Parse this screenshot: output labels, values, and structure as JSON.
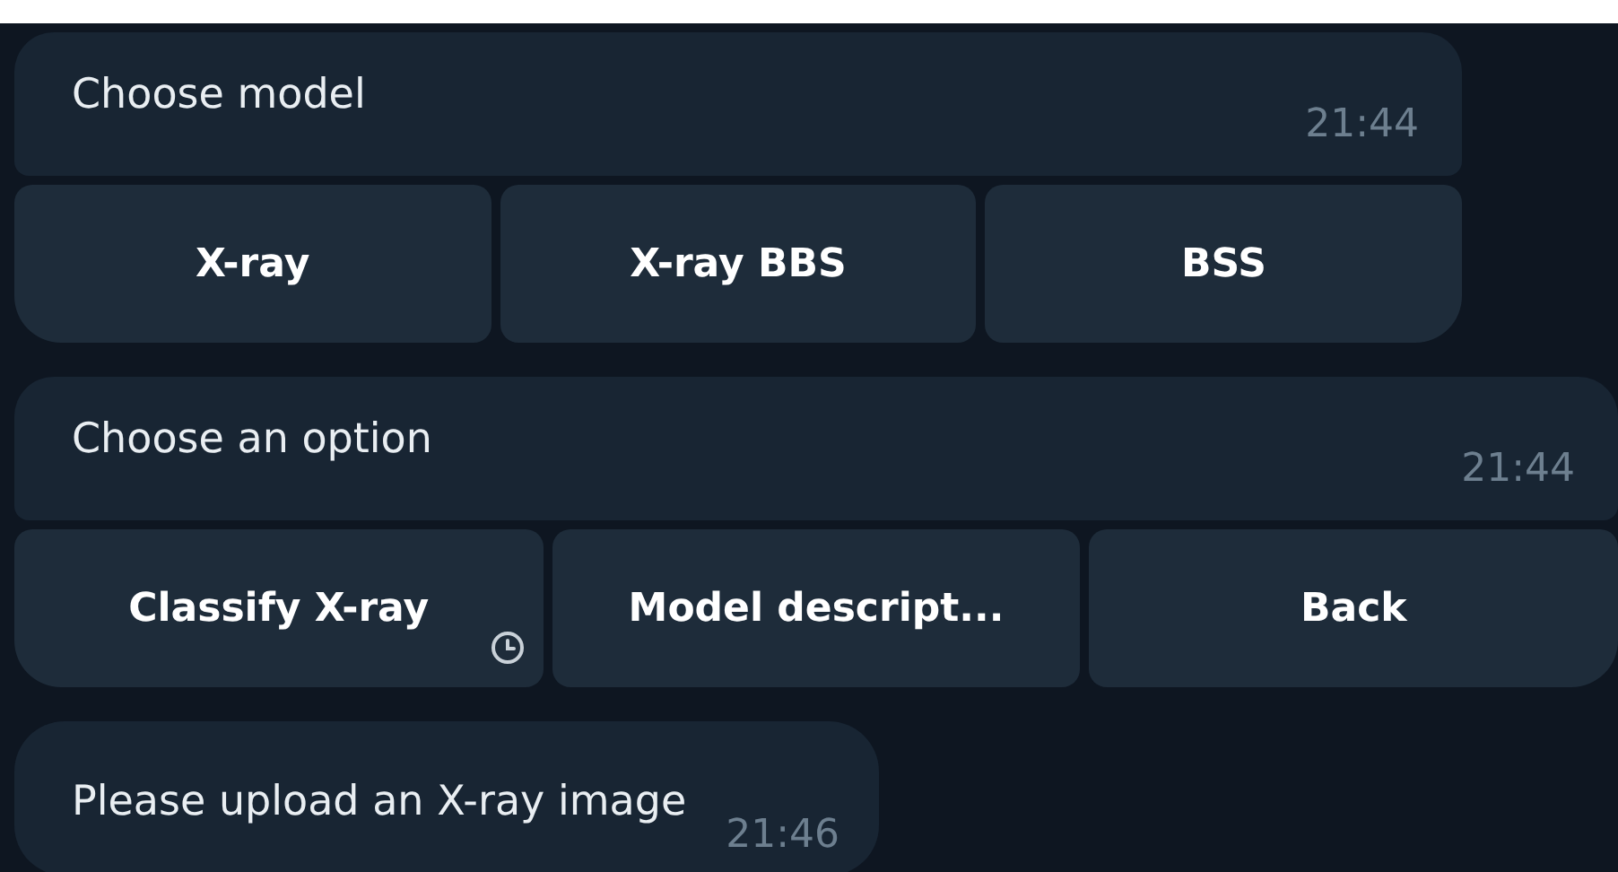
{
  "messages": [
    {
      "text": "Choose model",
      "time": "21:44",
      "keyboard": [
        {
          "label": "X-ray",
          "pending": false
        },
        {
          "label": "X-ray BBS",
          "pending": false
        },
        {
          "label": "BSS",
          "pending": false
        }
      ]
    },
    {
      "text": "Choose an option",
      "time": "21:44",
      "keyboard": [
        {
          "label": "Classify X-ray",
          "pending": true
        },
        {
          "label": "Model descript...",
          "pending": false
        },
        {
          "label": "Back",
          "pending": false
        }
      ]
    },
    {
      "text": "Please upload an X-ray image",
      "time": "21:46"
    }
  ]
}
